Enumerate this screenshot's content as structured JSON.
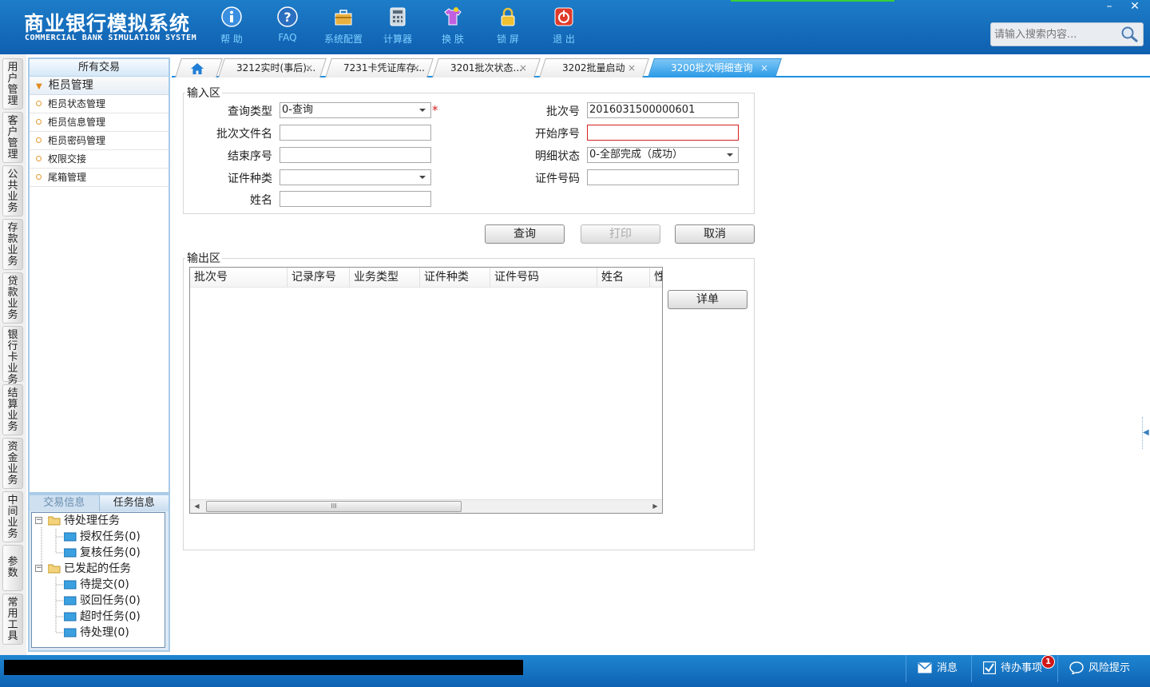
{
  "app": {
    "title": "商业银行模拟系统",
    "subtitle": "COMMERCIAL BANK SIMULATION SYSTEM"
  },
  "toolbar": [
    {
      "label": "帮 助",
      "icon": "info-icon"
    },
    {
      "label": "FAQ",
      "icon": "question-icon"
    },
    {
      "label": "系统配置",
      "icon": "toolbox-icon"
    },
    {
      "label": "计算器",
      "icon": "calculator-icon"
    },
    {
      "label": "换 肤",
      "icon": "shirt-icon"
    },
    {
      "label": "锁 屏",
      "icon": "lock-icon"
    },
    {
      "label": "退 出",
      "icon": "power-icon"
    }
  ],
  "window": {
    "minimize": "–",
    "close": "✕"
  },
  "search": {
    "placeholder": "请输入搜索内容..."
  },
  "vnav": [
    "用户管理",
    "客户管理",
    "公共业务",
    "存款业务",
    "贷款业务",
    "银行卡业务",
    "结算业务",
    "资金业务",
    "中间业务",
    "参数",
    "常用工具"
  ],
  "tree": {
    "header": "所有交易",
    "group": "柜员管理",
    "items": [
      "柜员状态管理",
      "柜员信息管理",
      "柜员密码管理",
      "权限交接",
      "尾箱管理"
    ]
  },
  "tasks": {
    "tabs": [
      "交易信息",
      "任务信息"
    ],
    "pending": "待处理任务",
    "pending_children": [
      "授权任务(0)",
      "复核任务(0)"
    ],
    "started": "已发起的任务",
    "started_children": [
      "待提交(0)",
      "驳回任务(0)",
      "超时任务(0)",
      "待处理(0)"
    ]
  },
  "tabs": [
    {
      "label": "3212实时(事后)...",
      "close": "×"
    },
    {
      "label": "7231卡凭证库存...",
      "close": "×"
    },
    {
      "label": "3201批次状态...",
      "close": "×"
    },
    {
      "label": "3202批量启动",
      "close": "×"
    },
    {
      "label": "3200批次明细查询",
      "close": "×",
      "active": true
    }
  ],
  "input_area": {
    "legend": "输入区",
    "query_type_label": "查询类型",
    "query_type_value": "0-查询",
    "required_mark": "*",
    "batch_no_label": "批次号",
    "batch_no_value": "2016031500000601",
    "batch_file_label": "批次文件名",
    "batch_file_value": "",
    "start_seq_label": "开始序号",
    "start_seq_value": "",
    "end_seq_label": "结束序号",
    "end_seq_value": "",
    "detail_status_label": "明细状态",
    "detail_status_value": "0-全部完成（成功）",
    "id_type_label": "证件种类",
    "id_type_value": "",
    "id_no_label": "证件号码",
    "id_no_value": "",
    "name_label": "姓名",
    "name_value": ""
  },
  "actions": {
    "query": "查询",
    "print": "打印",
    "cancel": "取消"
  },
  "output_area": {
    "legend": "输出区",
    "columns": [
      "批次号",
      "记录序号",
      "业务类型",
      "证件种类",
      "证件号码",
      "姓名",
      "性"
    ],
    "rows": [],
    "detail_button": "详单",
    "scroll_grip": "III"
  },
  "statusbar": {
    "message": "消息",
    "todo": "待办事项",
    "todo_count": "1",
    "risk": "风险提示"
  },
  "colors": {
    "header_bg": "#1470c0",
    "accent": "#1f8fe0",
    "toolbar_label": "#7fd0ff",
    "error_border": "#d42020"
  }
}
